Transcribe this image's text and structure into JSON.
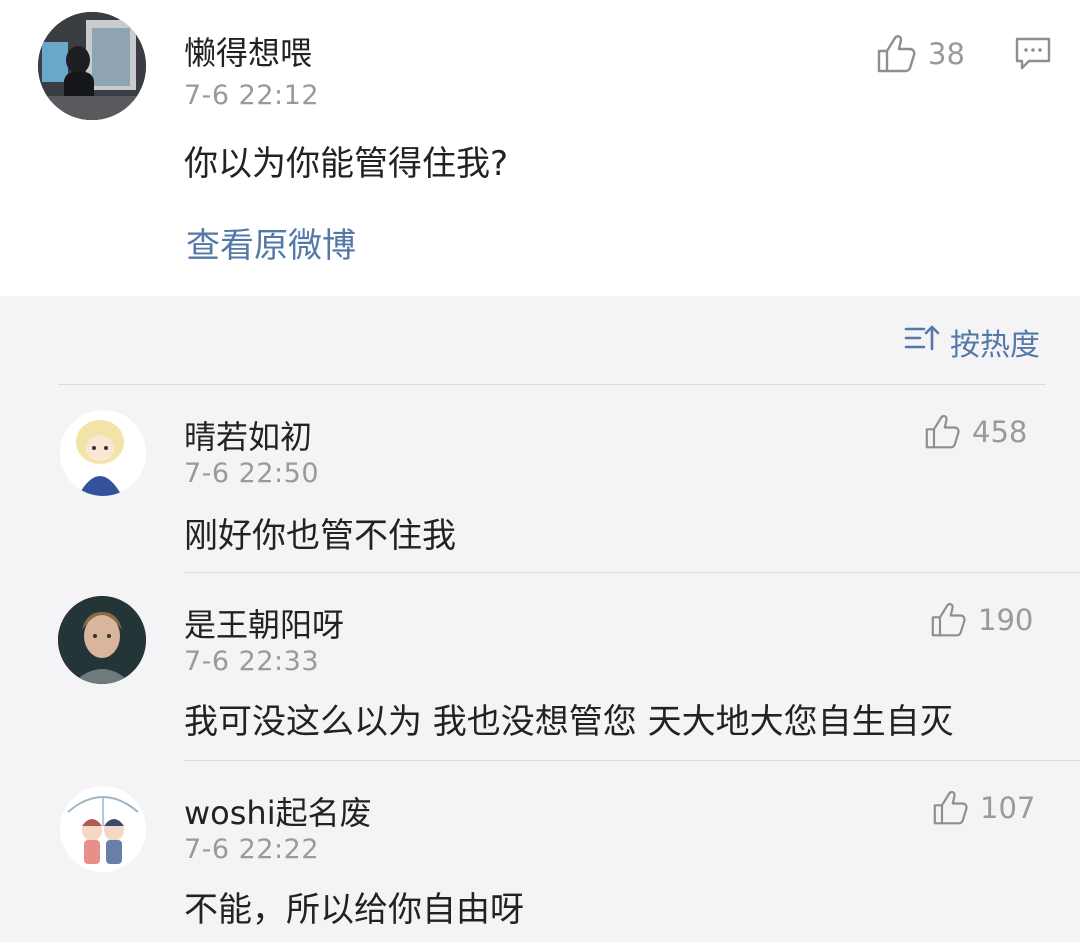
{
  "post": {
    "author": "懒得想喂",
    "time": "7-6 22:12",
    "text": "你以为你能管得住我?",
    "likes": "38",
    "view_original": "查看原微博"
  },
  "sort": {
    "label": "按热度",
    "icon": "sort-icon"
  },
  "comments": [
    {
      "author": "晴若如初",
      "time": "7-6 22:50",
      "text": "刚好你也管不住我",
      "likes": "458"
    },
    {
      "author": "是王朝阳呀",
      "time": "7-6 22:33",
      "text": "我可没这么以为 我也没想管您 天大地大您自生自灭",
      "likes": "190"
    },
    {
      "author": "woshi起名废",
      "time": "7-6 22:22",
      "text": "不能，所以给你自由呀",
      "likes": "107"
    }
  ],
  "colors": {
    "link": "#5479a8",
    "meta": "#9a9a9a",
    "background": "#f4f4f6"
  }
}
